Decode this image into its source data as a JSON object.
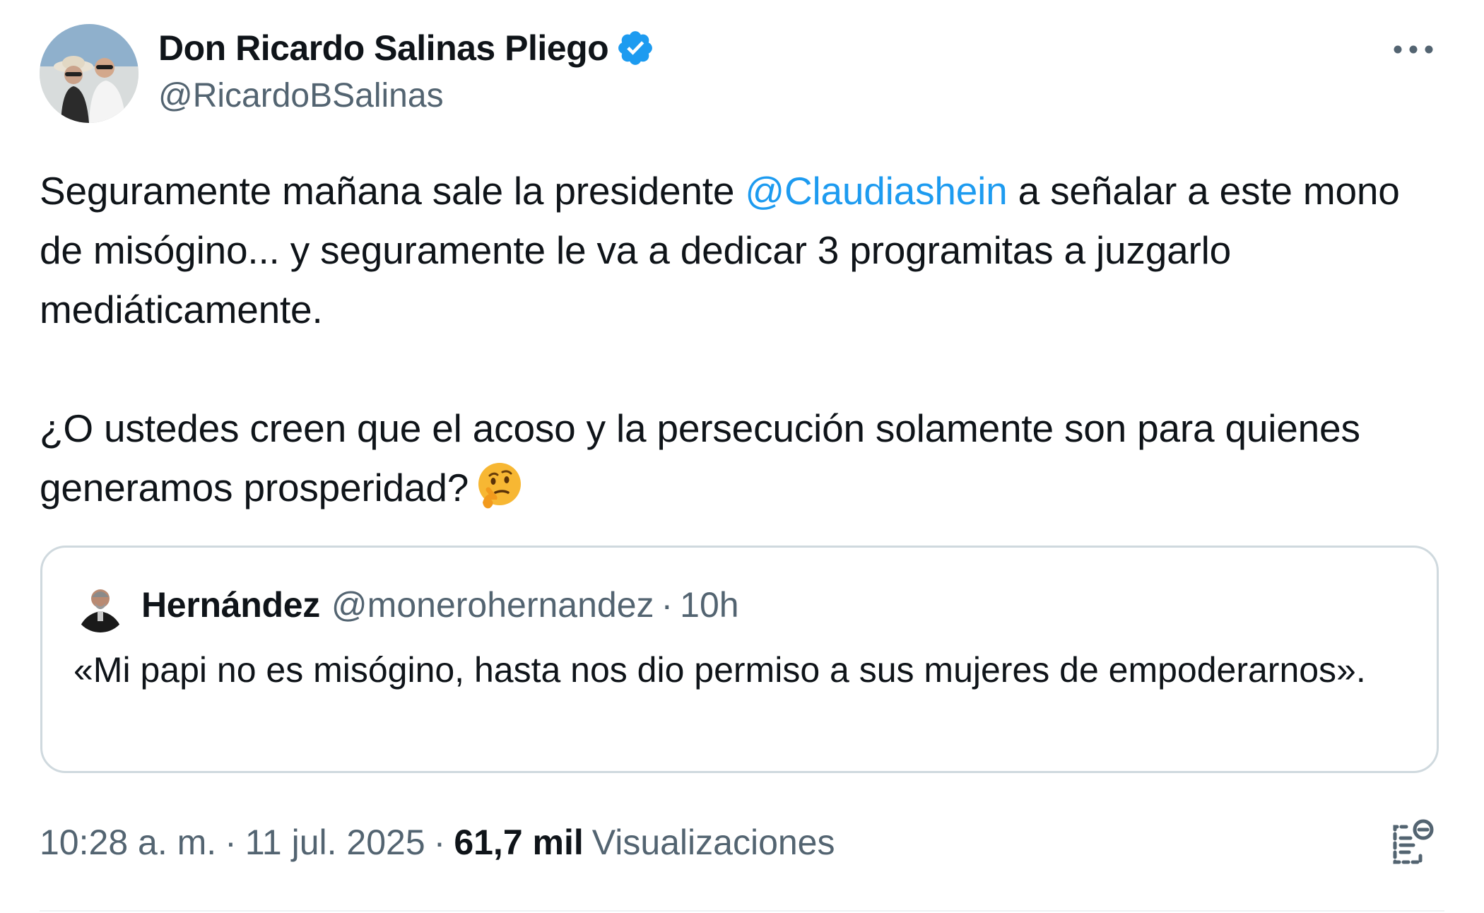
{
  "author": {
    "name": "Don Ricardo Salinas Pliego",
    "handle": "@RicardoBSalinas",
    "verified": true,
    "verified_color": "#1d9bf0"
  },
  "more_icon": "more-horizontal-icon",
  "tweet": {
    "line1_before": "Seguramente mañana sale la presidente ",
    "mention": "@Claudiashein",
    "line1_after": " a señalar a este mono de misógino... y seguramente le va a dedicar 3 programitas a juzgarlo mediáticamente.",
    "paragraph2": "¿O ustedes creen que el acoso y la persecución solamente son para quienes generamos prosperidad?",
    "emoji": "thinking-face-icon"
  },
  "quote": {
    "name": "Hernández",
    "handle": "@monerohernandez",
    "separator": "·",
    "time": "10h",
    "text": "«Mi papi no es misógino, hasta nos dio permiso a sus mujeres de empoderarnos»."
  },
  "meta": {
    "time": "10:28 a. m.",
    "separator": "·",
    "date": "11 jul. 2025",
    "views_count": "61,7 mil",
    "views_label": "Visualizaciones"
  },
  "colors": {
    "text": "#0f1419",
    "secondary": "#536471",
    "link": "#1d9bf0",
    "border": "#cfd9de"
  }
}
